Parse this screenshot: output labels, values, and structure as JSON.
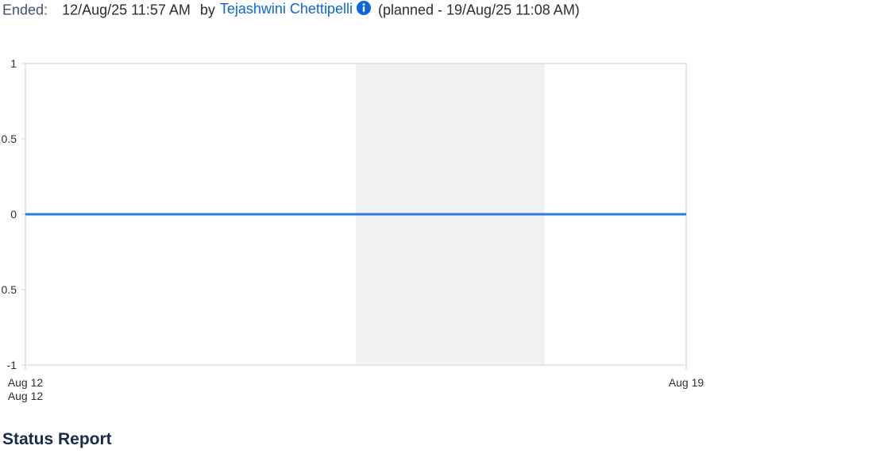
{
  "sprint_info": {
    "ended_label": "Ended:",
    "ended_datetime": "12/Aug/25 11:57 AM",
    "by_label": "by",
    "user_name": "Tejashwini Chettipelli",
    "info_icon": "info-circle-icon",
    "planned_text": "(planned - 19/Aug/25 11:08 AM)"
  },
  "chart_data": {
    "type": "line",
    "y_ticks": [
      "1",
      "0.5",
      "0",
      "0.5",
      "-1"
    ],
    "y_values": [
      1,
      0.5,
      0,
      -0.5,
      -1
    ],
    "ylim": [
      -1,
      1
    ],
    "x_tick_labels": [
      {
        "label": "Aug 12",
        "day": 12
      },
      {
        "label": "Aug 19",
        "day": 19
      }
    ],
    "x_extra_label": "Aug 12",
    "xlim": [
      12,
      19
    ],
    "shaded_period": [
      15.5,
      17.5
    ],
    "series": [
      {
        "points": [
          {
            "day": 12,
            "value": 0
          },
          {
            "day": 19,
            "value": 0
          }
        ]
      }
    ],
    "line_color": "#2a7de1",
    "shade_color": "#f0f1f3",
    "axis_color": "#dcdfe4"
  },
  "section": {
    "status_report_title": "Status Report"
  }
}
